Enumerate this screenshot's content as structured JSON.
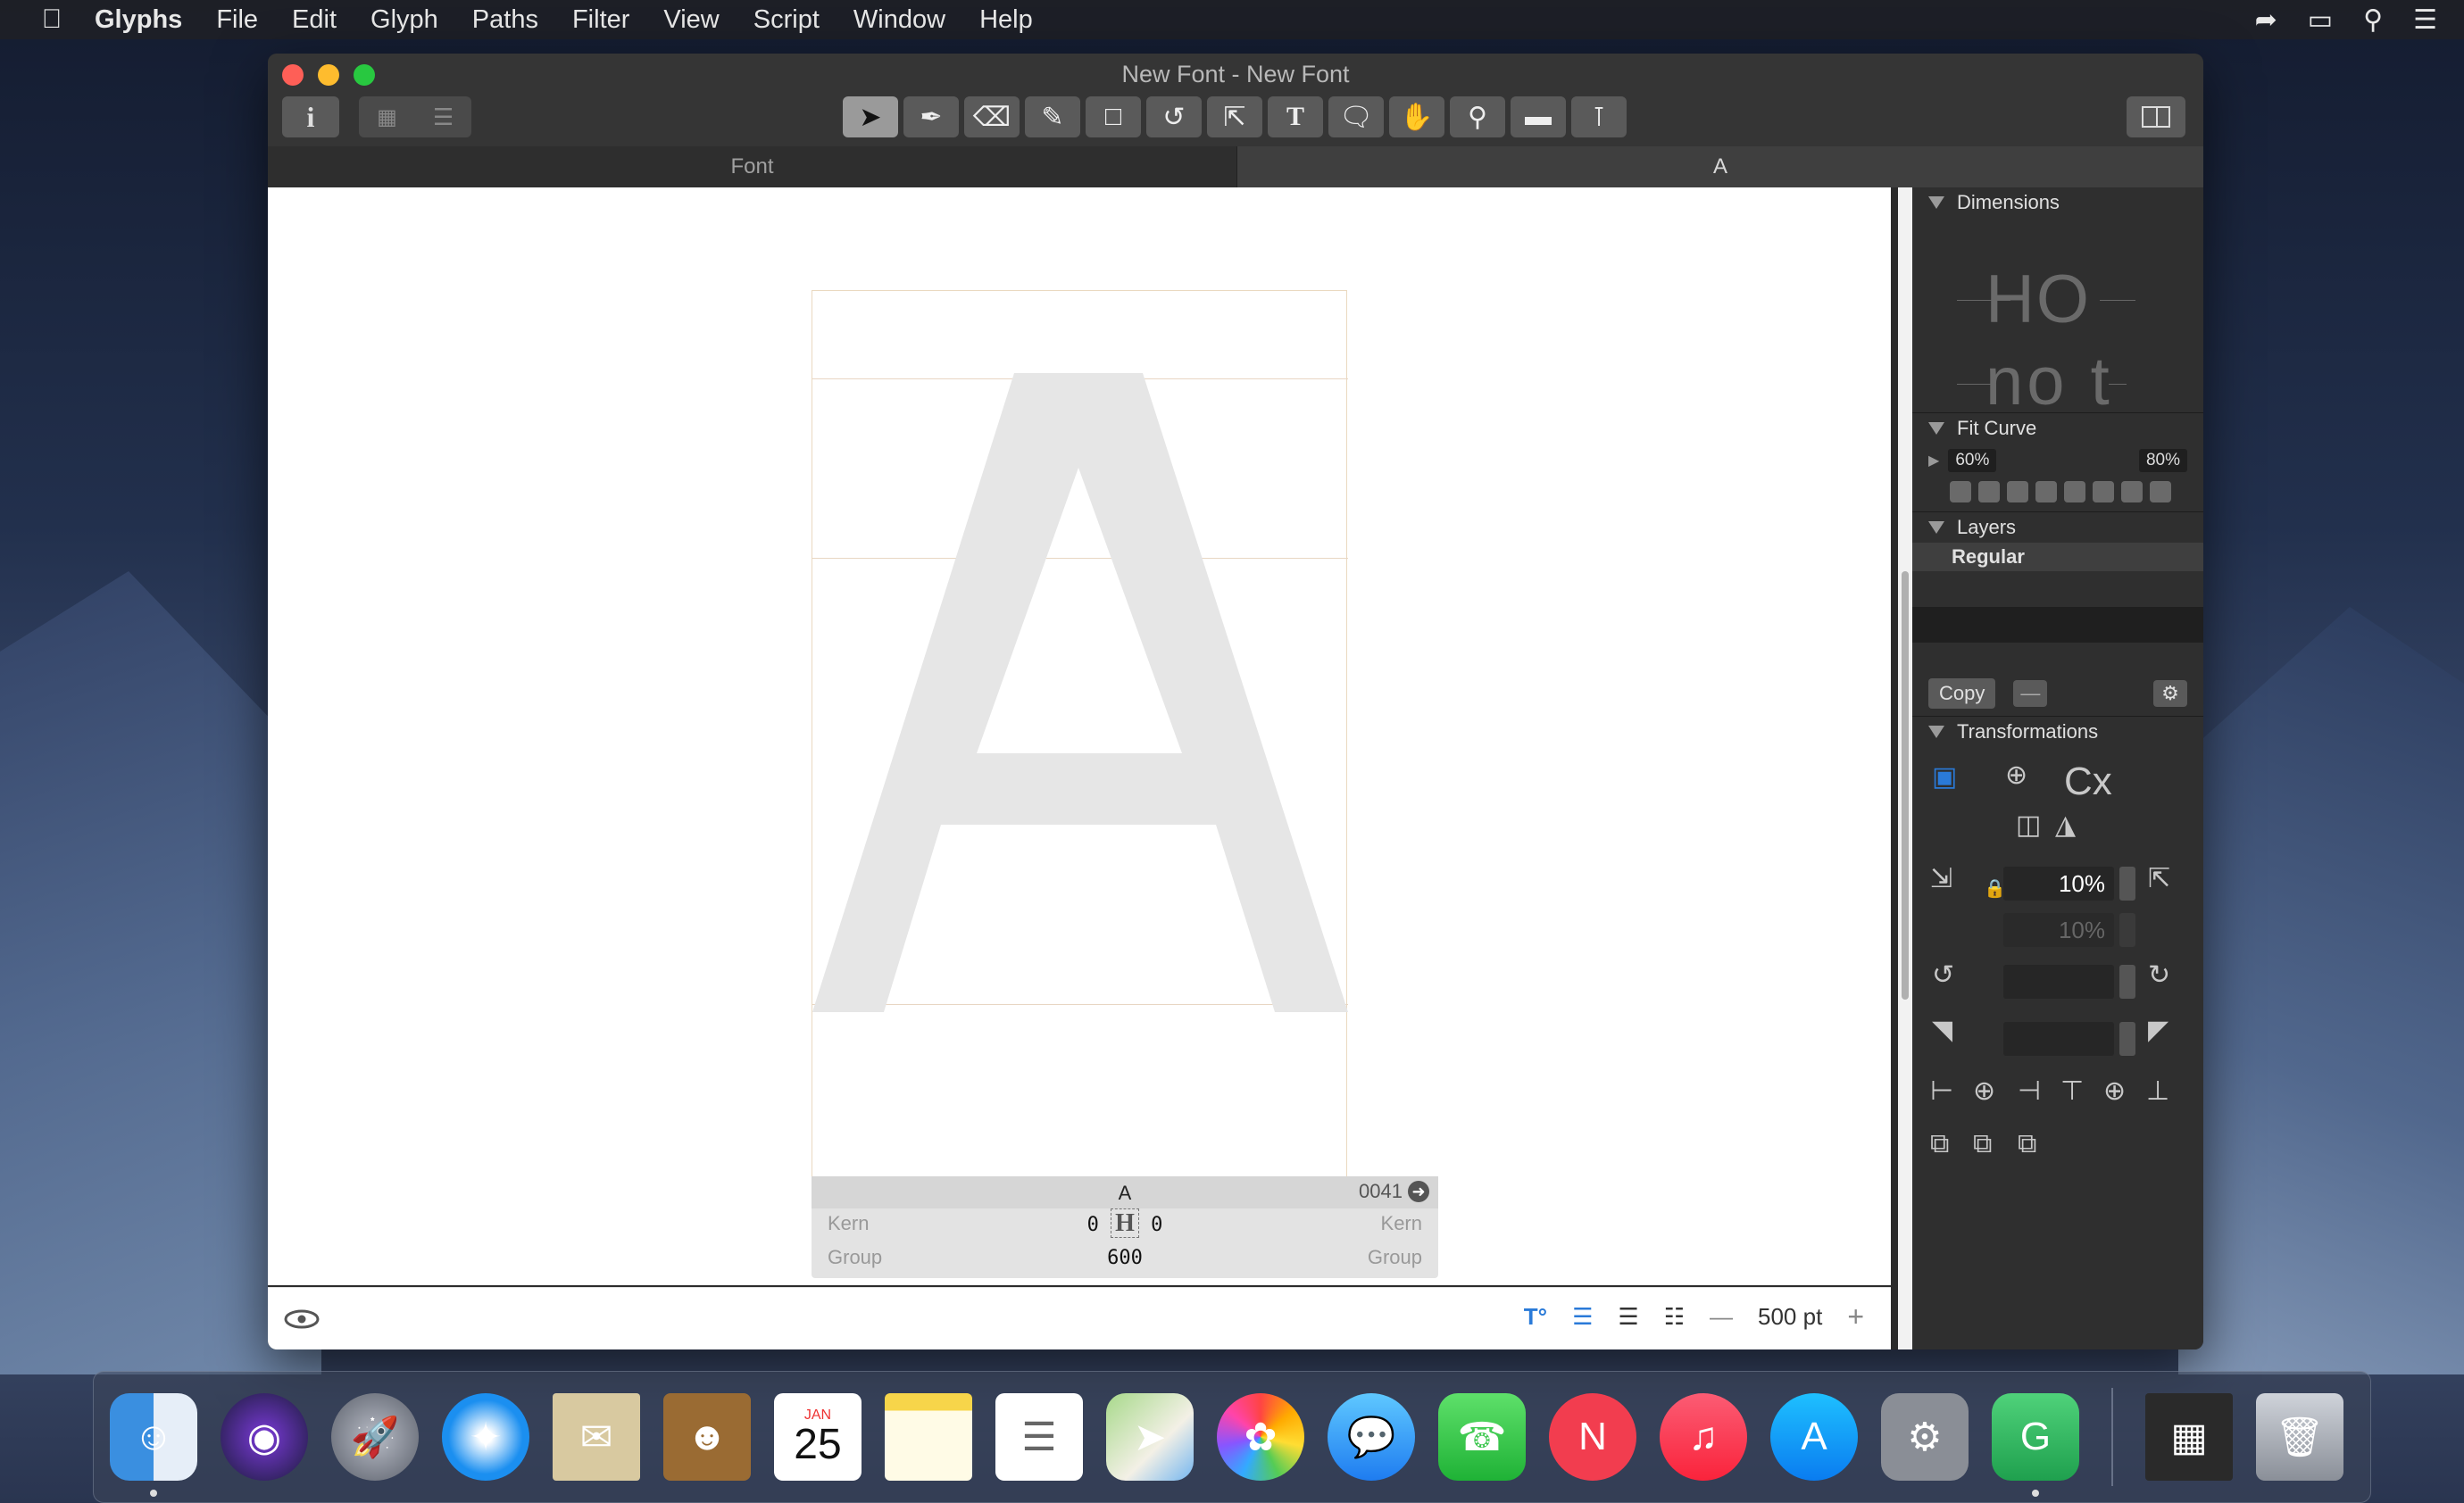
{
  "menubar": {
    "app": "Glyphs",
    "items": [
      "File",
      "Edit",
      "Glyph",
      "Paths",
      "Filter",
      "View",
      "Script",
      "Window",
      "Help"
    ]
  },
  "window": {
    "title": "New Font - New Font",
    "tabs": [
      {
        "label": "Font"
      },
      {
        "label": "A"
      }
    ]
  },
  "toolbar": {
    "info_label": "i",
    "text_tool": "T"
  },
  "canvas": {
    "glyph_char": "A",
    "info": {
      "glyph_name": "A",
      "unicode": "0041",
      "kern_left_label": "Kern",
      "kern_right_label": "Kern",
      "group_left_label": "Group",
      "group_right_label": "Group",
      "lsb": "0",
      "rsb": "0",
      "width": "600"
    }
  },
  "bottom": {
    "font_size": "500 pt",
    "minus": "—",
    "plus": "+"
  },
  "panel": {
    "dimensions_label": "Dimensions",
    "dim_preview_1": "HO",
    "dim_preview_2": "no t",
    "fit_curve_label": "Fit Curve",
    "fit_min": "60%",
    "fit_max": "80%",
    "layers_label": "Layers",
    "layer_name": "Regular",
    "copy_label": "Copy",
    "transformations_label": "Transformations",
    "scale_x": "10%",
    "scale_y": "10%",
    "rotate": "",
    "slant": ""
  },
  "dock": {
    "calendar_month": "JAN",
    "calendar_day": "25"
  }
}
